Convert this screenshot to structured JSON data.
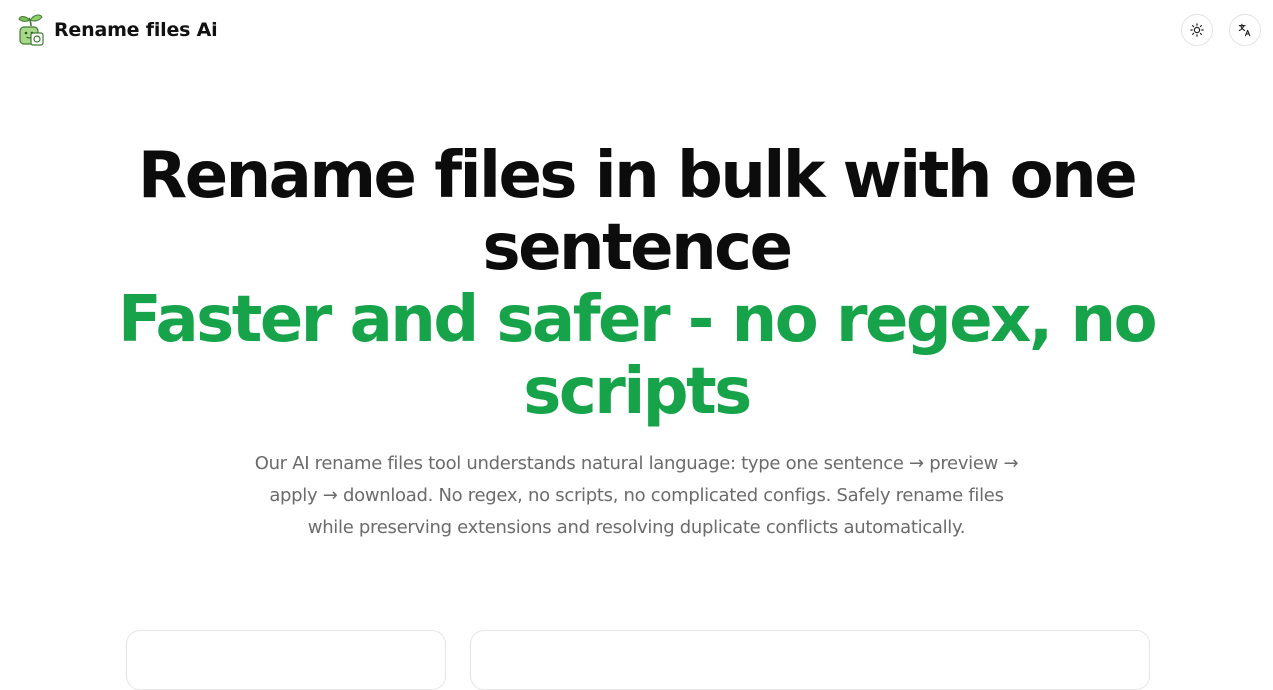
{
  "header": {
    "brand_name": "Rename files Ai",
    "logo_icon": "sprout-folder-icon",
    "theme_toggle_icon": "sun-icon",
    "language_icon": "translate-icon"
  },
  "hero": {
    "title": "Rename files in bulk with one sentence",
    "subtitle": "Faster and safer - no regex, no scripts",
    "description": "Our AI rename files tool understands natural language: type one sentence → preview → apply → download. No regex, no scripts, no complicated configs. Safely rename files while preserving extensions and resolving duplicate conflicts automatically."
  },
  "colors": {
    "accent": "#16a34a",
    "title": "#0c0c0c",
    "muted": "#6b6b6b",
    "border": "#e6e6e6"
  }
}
